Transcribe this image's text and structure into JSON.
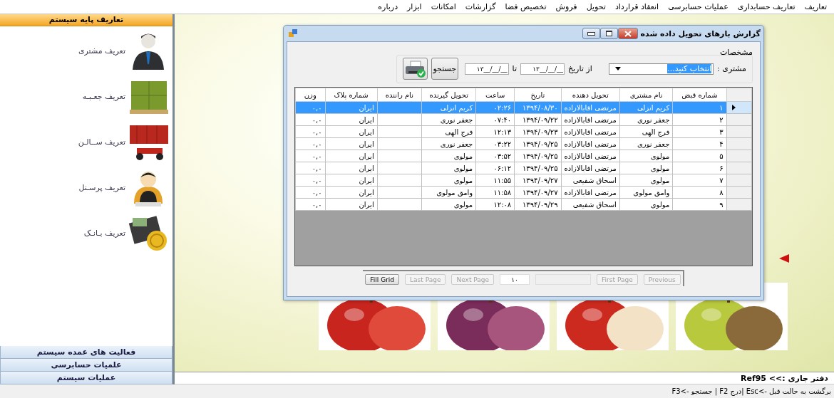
{
  "menu": {
    "items": [
      "تعاریف",
      "تعاریف حسابداری",
      "عملیات حسابرسی",
      "انعقاد قرارداد",
      "تحویل",
      "فروش",
      "تخصیص فضا",
      "گزارشات",
      "امکانات",
      "ابزار",
      "درباره"
    ]
  },
  "sidebar": {
    "header": "تعاریف پایه سیستم",
    "items": [
      {
        "label": "تعریف مشتری",
        "kind": "customer"
      },
      {
        "label": "تعریف جعـبـه",
        "kind": "boxes"
      },
      {
        "label": "تعریف ســالـن",
        "kind": "container"
      },
      {
        "label": "تعریف پرسـنل",
        "kind": "staff"
      },
      {
        "label": "تعریف بـانـک",
        "kind": "bank"
      }
    ],
    "sections": [
      "فعالیت های عمده سیستم",
      "علمیات حسابرسی",
      "عملیات سیستم"
    ]
  },
  "dialog": {
    "title": "گزارش بارهای تحویل داده شده",
    "group_label": "مشخصات",
    "customer_label": "مشتری :",
    "customer_value": "انتخاب کنید...",
    "from_label": "از تاریخ",
    "from_value": "۱۳__/__/__",
    "to_label": "تا",
    "to_value": "۱۳__/__/__",
    "search_button": "جستجو",
    "table": {
      "columns": [
        "شماره قبض",
        "نام مشتری",
        "تحویل دهنده",
        "تاریخ",
        "ساعت",
        "تحویل گیرنده",
        "نام راننده",
        "شماره پلاک",
        "وزن"
      ],
      "rows": [
        {
          "selected": true,
          "cells": [
            "۱",
            "کریم انزلی",
            "مرتضی  اقابالازاده",
            "۱۳۹۴/۰۸/۳۰",
            "۰۲:۲۶",
            "کریم انزلی",
            null,
            "ایران",
            "۰,۰"
          ]
        },
        {
          "selected": false,
          "cells": [
            "۲",
            "جعفر نوری",
            "مرتضی  اقابالازاده",
            "۱۳۹۴/۰۹/۲۲",
            "۰۷:۴۰",
            "جعفر نوری",
            null,
            "ایران",
            "۰,۰"
          ]
        },
        {
          "selected": false,
          "cells": [
            "۳",
            "فرج الهی",
            "مرتضی  اقابالازاده",
            "۱۳۹۴/۰۹/۲۳",
            "۱۲:۱۳",
            "فرج الهی",
            null,
            "ایران",
            "۰,۰"
          ]
        },
        {
          "selected": false,
          "cells": [
            "۴",
            "جعفر نوری",
            "مرتضی  اقابالازاده",
            "۱۳۹۴/۰۹/۲۵",
            "۰۳:۲۲",
            "جعفر نوری",
            null,
            "ایران",
            "۰,۰"
          ]
        },
        {
          "selected": false,
          "cells": [
            "۵",
            "مولوی",
            "مرتضی  اقابالازاده",
            "۱۳۹۴/۰۹/۲۵",
            "۰۳:۵۲",
            "مولوی",
            null,
            "ایران",
            "۰,۰"
          ]
        },
        {
          "selected": false,
          "cells": [
            "۶",
            "مولوی",
            "مرتضی  اقابالازاده",
            "۱۳۹۴/۰۹/۲۵",
            "۰۶:۱۲",
            "مولوی",
            null,
            "ایران",
            "۰,۰"
          ]
        },
        {
          "selected": false,
          "cells": [
            "۷",
            "مولوی",
            "اسحاق  شفیعی",
            "۱۳۹۴/۰۹/۲۷",
            "۱۱:۵۵",
            "مولوی",
            null,
            "ایران",
            "۰,۰"
          ]
        },
        {
          "selected": false,
          "cells": [
            "۸",
            "وامق مولوی",
            "مرتضی  اقابالازاده",
            "۱۳۹۴/۰۹/۲۷",
            "۱۱:۵۸",
            "وامق مولوی",
            null,
            "ایران",
            "۰,۰"
          ]
        },
        {
          "selected": false,
          "cells": [
            "۹",
            "مولوی",
            "اسحاق  شفیعی",
            "۱۳۹۴/۰۹/۲۹",
            "۱۲:۰۸",
            "مولوی",
            null,
            "ایران",
            "۰,۰"
          ]
        }
      ]
    },
    "pager": [
      {
        "kind": "button",
        "label": "Previous",
        "disabled": true
      },
      {
        "kind": "button",
        "label": "First Page",
        "disabled": true
      },
      {
        "kind": "field"
      },
      {
        "kind": "field",
        "value": "۱۰"
      },
      {
        "kind": "button",
        "label": "Next Page",
        "disabled": true
      },
      {
        "kind": "button",
        "label": "Last Page",
        "disabled": true
      },
      {
        "kind": "button",
        "label": "Fill Grid",
        "disabled": false
      }
    ]
  },
  "status_bar": {
    "office": "دفتر جاری :>> Ref95",
    "hint": "برگشت به حالت قبل ->Esc |درج F2 | جستجو ->F3"
  }
}
